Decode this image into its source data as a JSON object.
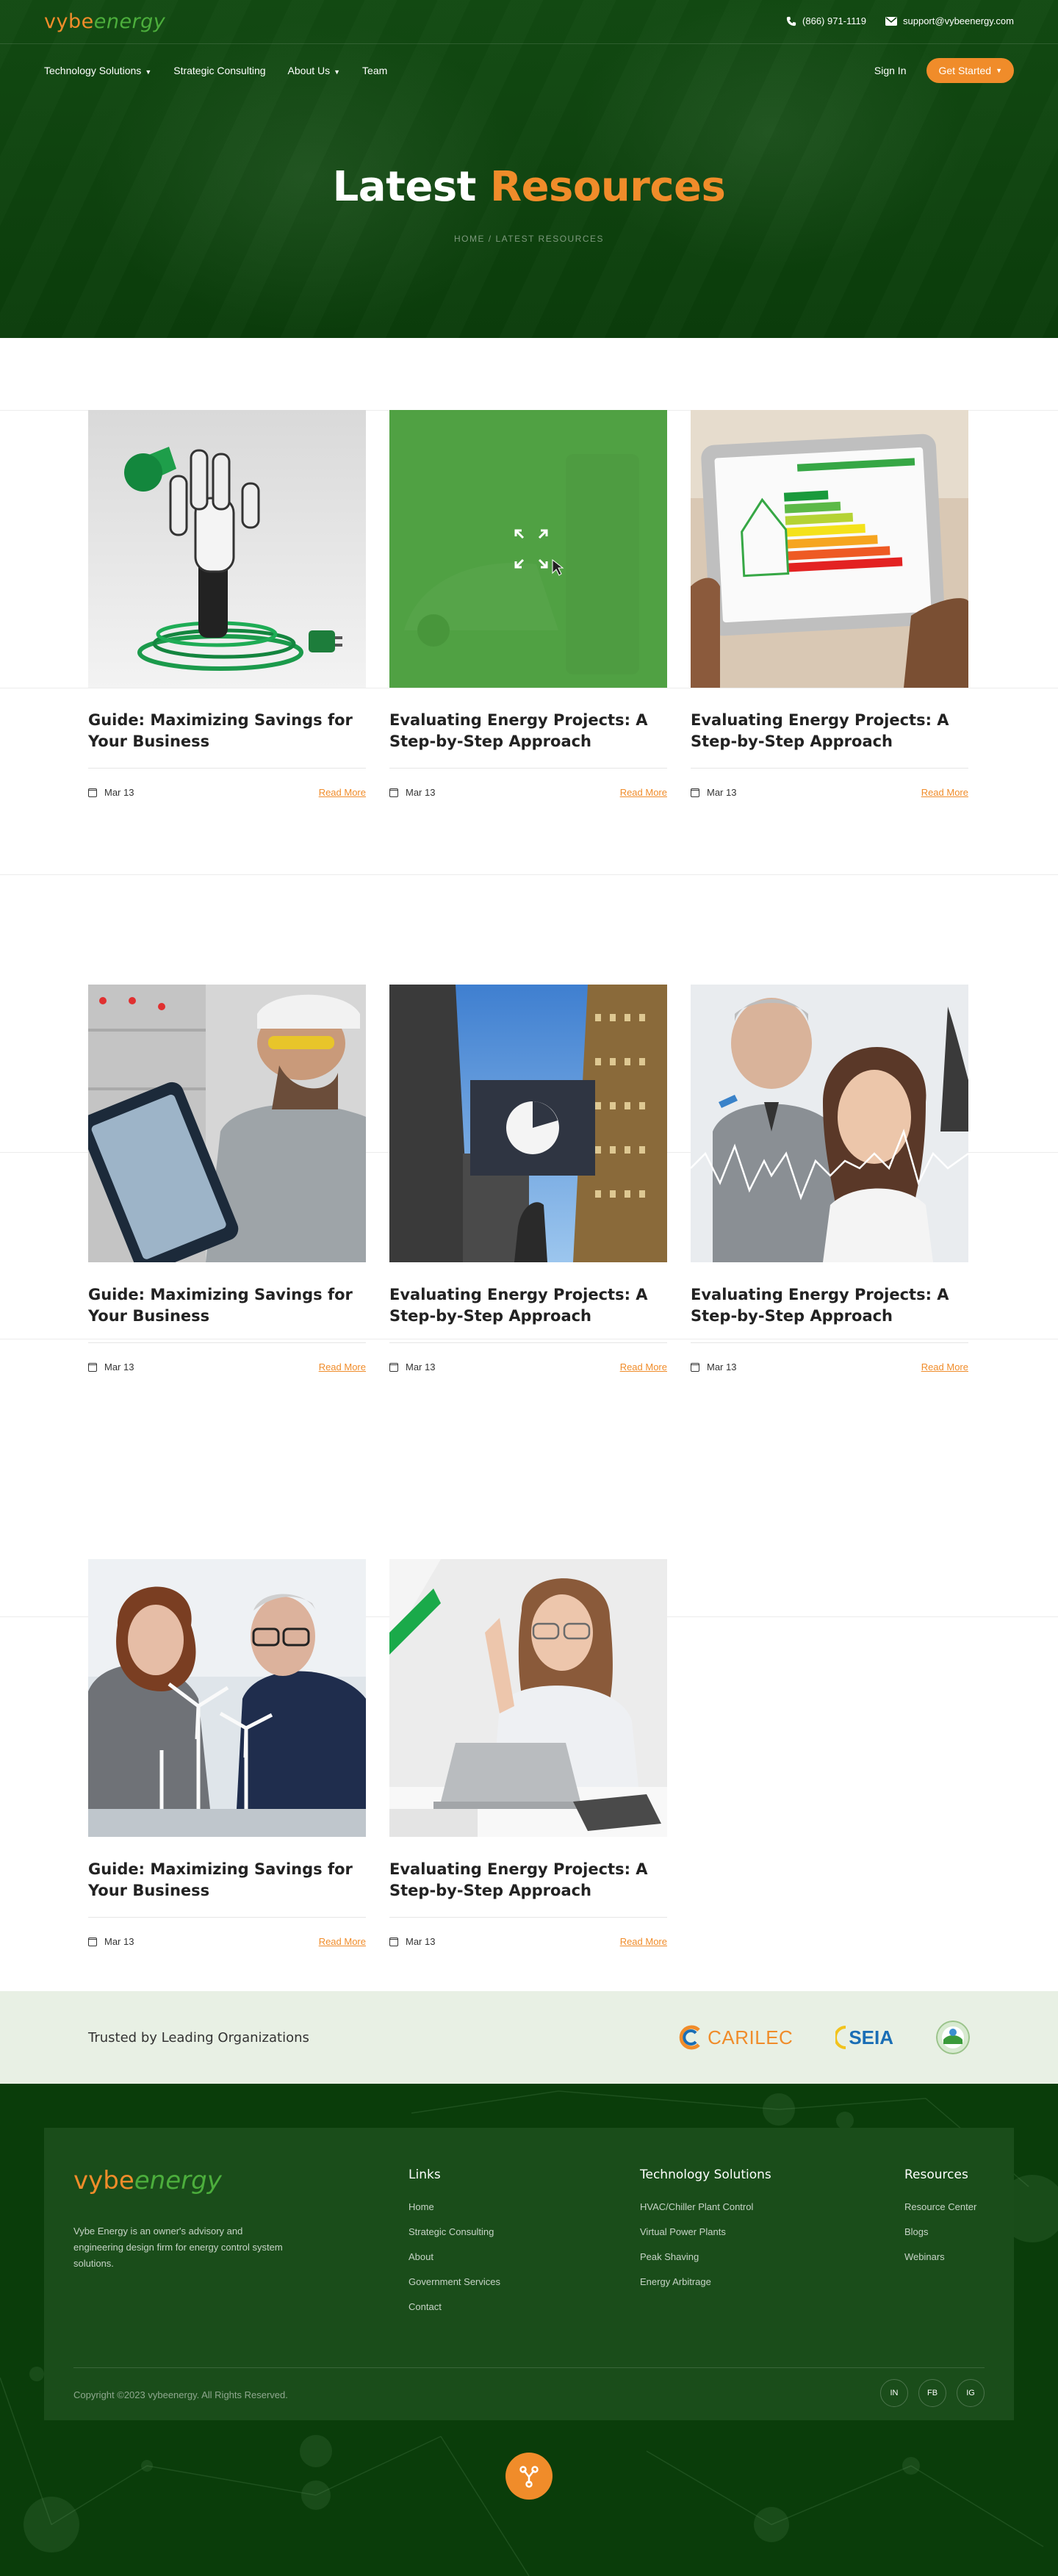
{
  "brand": {
    "logo_part1": "vybe",
    "logo_part2": "energy"
  },
  "header": {
    "phone": "(866) 971-1119",
    "email": "support@vybeenergy.com",
    "nav": [
      {
        "label": "Technology Solutions",
        "has_dropdown": true
      },
      {
        "label": "Strategic Consulting",
        "has_dropdown": false
      },
      {
        "label": "About Us",
        "has_dropdown": true
      },
      {
        "label": "Team",
        "has_dropdown": false
      }
    ],
    "sign_in": "Sign In",
    "cta": "Get Started"
  },
  "hero": {
    "title_white": "Latest",
    "title_orange": "Resources",
    "breadcrumb": "HOME / LATEST RESOURCES"
  },
  "posts": [
    {
      "title": "Guide: Maximizing Savings for Your Business",
      "date": "Mar 13",
      "link": "Read More",
      "image": "green-charging-plug"
    },
    {
      "title": "Evaluating Energy Projects: A Step-by-Step Approach",
      "date": "Mar 13",
      "link": "Read More",
      "image": "ev-charging-hover"
    },
    {
      "title": "Evaluating Energy Projects: A Step-by-Step Approach",
      "date": "Mar 13",
      "link": "Read More",
      "image": "energy-efficiency-tablet"
    },
    {
      "title": "Guide: Maximizing Savings for Your Business",
      "date": "Mar 13",
      "link": "Read More",
      "image": "technician-tablet"
    },
    {
      "title": "Evaluating Energy Projects: A Step-by-Step Approach",
      "date": "Mar 13",
      "link": "Read More",
      "image": "pie-chart-skyscrapers"
    },
    {
      "title": "Evaluating Energy Projects: A Step-by-Step Approach",
      "date": "Mar 13",
      "link": "Read More",
      "image": "analysts-graph"
    },
    {
      "title": "Guide: Maximizing Savings for Your Business",
      "date": "Mar 13",
      "link": "Read More",
      "image": "wind-turbine-models"
    },
    {
      "title": "Evaluating Energy Projects: A Step-by-Step Approach",
      "date": "Mar 13",
      "link": "Read More",
      "image": "woman-laptop"
    }
  ],
  "trusted": {
    "text": "Trusted by Leading Organizations",
    "logos": [
      "CARILEC",
      "SEIA",
      "round-seal"
    ]
  },
  "footer": {
    "description": "Vybe Energy is an owner's advisory and engineering design firm for energy control system solutions.",
    "links_title": "Links",
    "links": [
      "Home",
      "Strategic Consulting",
      "About",
      "Government Services",
      "Contact"
    ],
    "tech_title": "Technology Solutions",
    "tech": [
      "HVAC/Chiller Plant Control",
      "Virtual Power Plants",
      "Peak Shaving",
      "Energy Arbitrage"
    ],
    "res_title": "Resources",
    "res": [
      "Resource Center",
      "Blogs",
      "Webinars"
    ],
    "copyright": "Copyright ©2023 vybeenergy. All Rights Reserved.",
    "social": [
      "IN",
      "FB",
      "IG"
    ]
  },
  "colors": {
    "brand_green": "#0a3d0a",
    "accent_orange": "#f08c2a",
    "leaf_green": "#4cae3c"
  }
}
